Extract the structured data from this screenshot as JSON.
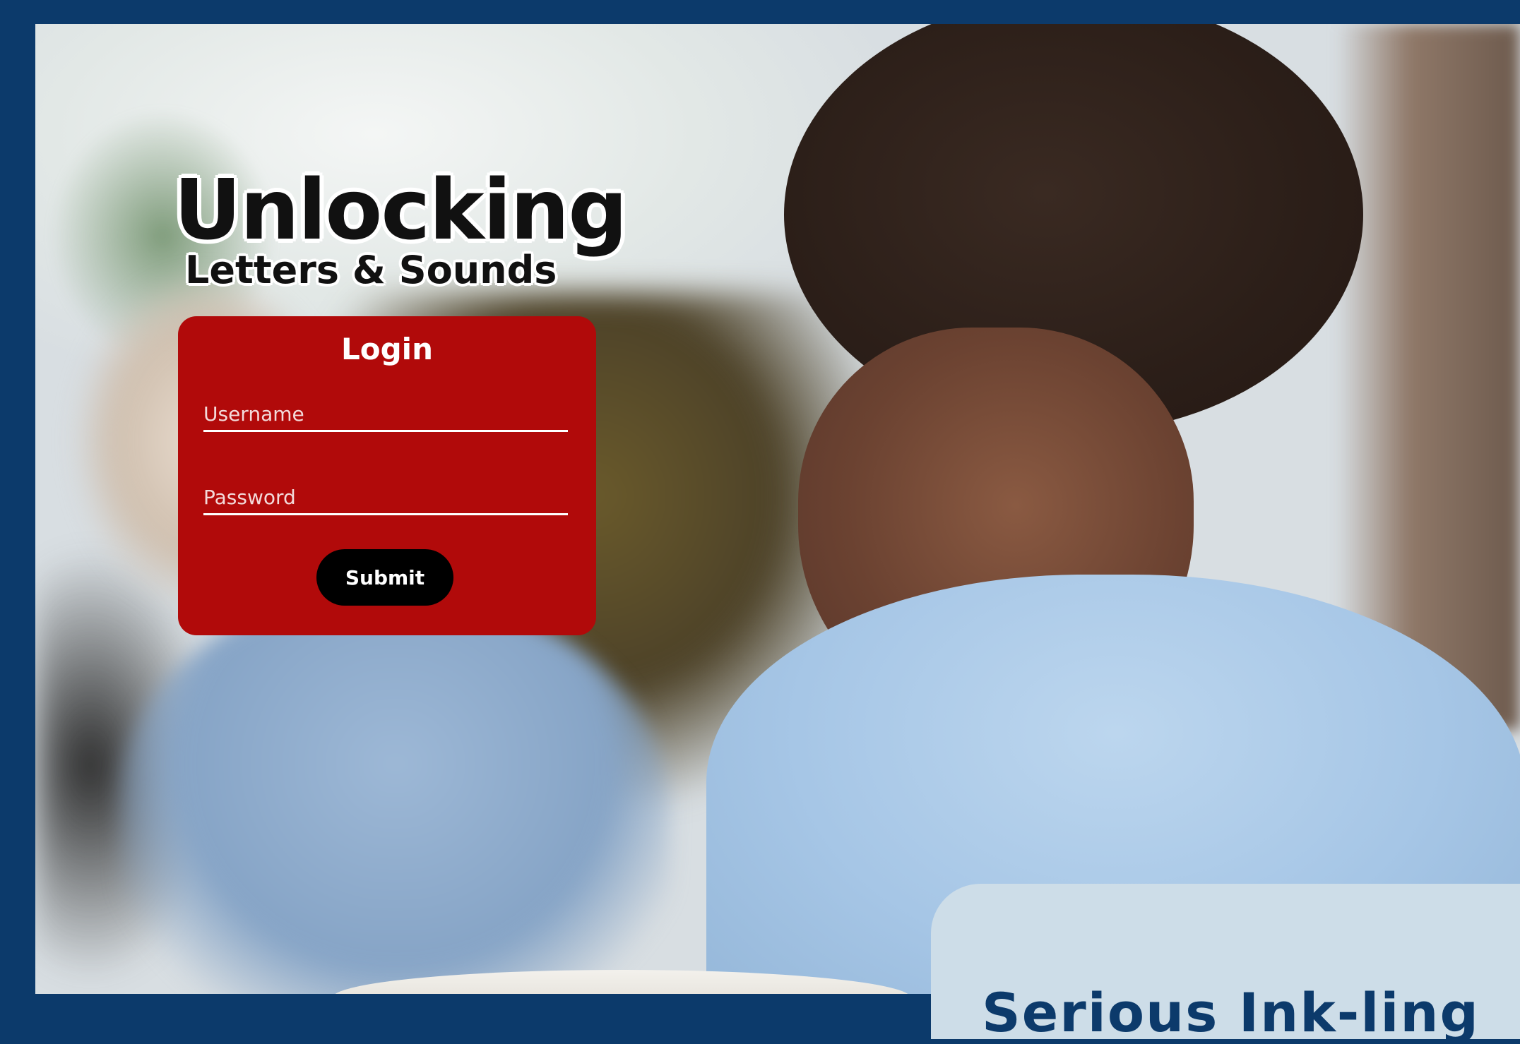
{
  "brand": {
    "logo_main": "Unlocking",
    "logo_sub": "Letters & Sounds"
  },
  "login": {
    "title": "Login",
    "username_placeholder": "Username",
    "password_placeholder": "Password",
    "submit_label": "Submit"
  },
  "info_panel": {
    "heading": "Serious Ink-ling"
  },
  "colors": {
    "frame_border": "#0c3a6b",
    "login_card": "#b10a0a",
    "submit_button": "#000000",
    "info_panel": "#cddde8"
  }
}
